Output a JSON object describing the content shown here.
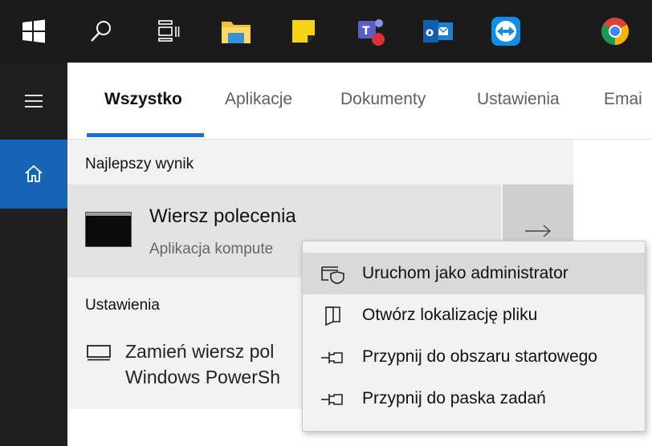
{
  "taskbar": {
    "items": [
      "start-windows",
      "search",
      "task-view",
      "file-explorer",
      "sticky-notes",
      "teams",
      "outlook",
      "teamviewer",
      "chrome"
    ]
  },
  "tabs": [
    {
      "label": "Wszystko",
      "active": true
    },
    {
      "label": "Aplikacje",
      "active": false
    },
    {
      "label": "Dokumenty",
      "active": false
    },
    {
      "label": "Ustawienia",
      "active": false
    },
    {
      "label": "Emai",
      "active": false
    }
  ],
  "best_match": {
    "section_label": "Najlepszy wynik",
    "title": "Wiersz polecenia",
    "subtitle": "Aplikacja kompute"
  },
  "settings_section": {
    "label": "Ustawienia",
    "item_line1": "Zamień wiersz pol",
    "item_line2": "Windows PowerSh"
  },
  "context_menu": {
    "items": [
      {
        "label": "Uruchom jako administrator",
        "icon": "run-as-admin-icon",
        "highlighted": true
      },
      {
        "label": "Otwórz lokalizację pliku",
        "icon": "file-location-icon",
        "highlighted": false
      },
      {
        "label": "Przypnij do obszaru startowego",
        "icon": "pin-icon",
        "highlighted": false
      },
      {
        "label": "Przypnij do paska zadań",
        "icon": "pin-icon",
        "highlighted": false
      }
    ]
  },
  "colors": {
    "accent": "#1874d2",
    "home_active": "#1565b4",
    "taskbar": "#1b1b1b"
  }
}
